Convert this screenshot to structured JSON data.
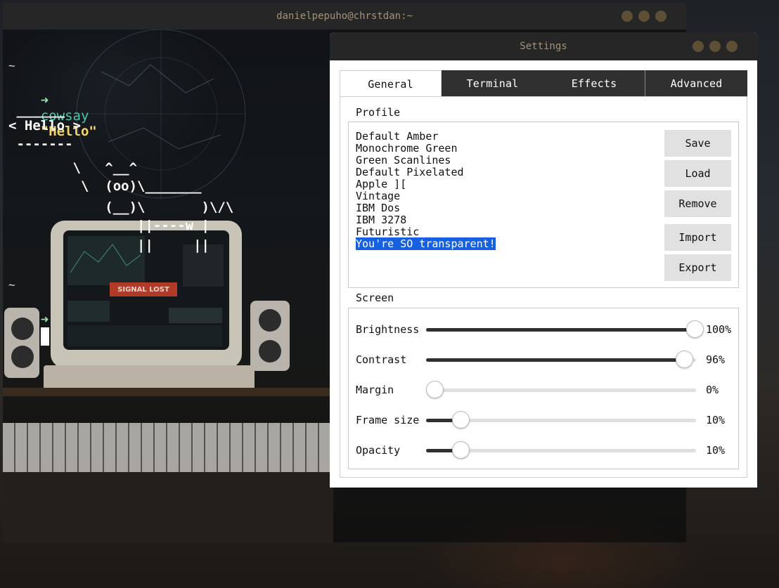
{
  "terminal": {
    "title": "danielpepuho@chrstdan:~",
    "lines": {
      "tilde1": "~",
      "prompt_arrow": "➜",
      "command": "cowsay",
      "argument": "\"Hello\"",
      "cow_top": " ______",
      "cow_say": "< Hello >",
      "cow_bottom": " -------",
      "cow_1": "        \\   ^__^",
      "cow_2": "         \\  (oo)\\_______",
      "cow_3": "            (__)\\       )\\/\\",
      "cow_4": "                ||----w |",
      "cow_5": "                ||     ||",
      "tilde2": "~"
    },
    "monitor_text": "SIGNAL LOST"
  },
  "settings": {
    "title": "Settings",
    "tabs": [
      {
        "label": "General",
        "active": true
      },
      {
        "label": "Terminal",
        "active": false
      },
      {
        "label": "Effects",
        "active": false
      },
      {
        "label": "Advanced",
        "active": false
      }
    ],
    "profile": {
      "title": "Profile",
      "items": [
        "Default Amber",
        "Monochrome Green",
        "Green Scanlines",
        "Default Pixelated",
        "Apple ][",
        "Vintage",
        "IBM Dos",
        "IBM 3278",
        "Futuristic",
        "You're SO transparent!"
      ],
      "selected_index": 9,
      "buttons": {
        "save": "Save",
        "load": "Load",
        "remove": "Remove",
        "import": "Import",
        "export": "Export"
      }
    },
    "screen": {
      "title": "Screen",
      "sliders": [
        {
          "label": "Brightness",
          "value": 1.0,
          "display": "100%"
        },
        {
          "label": "Contrast",
          "value": 0.96,
          "display": "96%"
        },
        {
          "label": "Margin",
          "value": 0.0,
          "display": "0%"
        },
        {
          "label": "Frame size",
          "value": 0.1,
          "display": "10%"
        },
        {
          "label": "Opacity",
          "value": 0.1,
          "display": "10%"
        }
      ]
    }
  },
  "colors": {
    "titlebar": "#262626",
    "title_text": "#a3937a",
    "window_button": "#5d4e36",
    "selection": "#1760e0",
    "command_teal": "#48c9a8",
    "string_yellow": "#f5d46c"
  }
}
